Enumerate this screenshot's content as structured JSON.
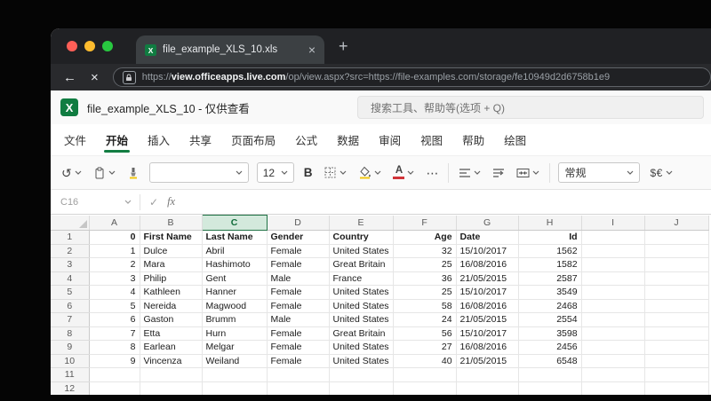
{
  "browser": {
    "tab_title": "file_example_XLS_10.xls",
    "url_prefix": "https://",
    "url_domain": "view.officeapps.live.com",
    "url_path": "/op/view.aspx?src=https://file-examples.com/storage/fe10949d2d6758b1e9"
  },
  "icons": {
    "back": "←",
    "stop": "×",
    "tab_close": "×",
    "new_tab": "+",
    "undo": "↺",
    "more": "⋯",
    "check": "✓",
    "fx": "fx"
  },
  "app": {
    "title": "file_example_XLS_10 - 仅供查看",
    "search_placeholder": "搜索工具、帮助等(选项 + Q)"
  },
  "menu": {
    "items": [
      "文件",
      "开始",
      "插入",
      "共享",
      "页面布局",
      "公式",
      "数据",
      "审阅",
      "视图",
      "帮助",
      "绘图"
    ],
    "keys": [
      "file",
      "home",
      "insert",
      "share",
      "page-layout",
      "formulas",
      "data",
      "review",
      "view",
      "help",
      "draw"
    ],
    "active": "开始"
  },
  "toolbar": {
    "font_name": "",
    "font_size": "12",
    "bold_label": "B",
    "font_color_label": "A",
    "number_format": "常规",
    "currency": "$€",
    "accent_green": "#127d42",
    "font_color_red": "#d13438",
    "highlight_yellow": "#f2c811"
  },
  "formula_bar": {
    "name_box": "C16"
  },
  "grid": {
    "columns": [
      "A",
      "B",
      "C",
      "D",
      "E",
      "F",
      "G",
      "H",
      "I",
      "J"
    ],
    "selected_column": "C",
    "rows": [
      {
        "n": "1",
        "c": [
          "0",
          "First Name",
          "Last Name",
          "Gender",
          "Country",
          "Age",
          "Date",
          "Id",
          "",
          ""
        ]
      },
      {
        "n": "2",
        "c": [
          "1",
          "Dulce",
          "Abril",
          "Female",
          "United States",
          "32",
          "15/10/2017",
          "1562",
          "",
          ""
        ]
      },
      {
        "n": "3",
        "c": [
          "2",
          "Mara",
          "Hashimoto",
          "Female",
          "Great Britain",
          "25",
          "16/08/2016",
          "1582",
          "",
          ""
        ]
      },
      {
        "n": "4",
        "c": [
          "3",
          "Philip",
          "Gent",
          "Male",
          "France",
          "36",
          "21/05/2015",
          "2587",
          "",
          ""
        ]
      },
      {
        "n": "5",
        "c": [
          "4",
          "Kathleen",
          "Hanner",
          "Female",
          "United States",
          "25",
          "15/10/2017",
          "3549",
          "",
          ""
        ]
      },
      {
        "n": "6",
        "c": [
          "5",
          "Nereida",
          "Magwood",
          "Female",
          "United States",
          "58",
          "16/08/2016",
          "2468",
          "",
          ""
        ]
      },
      {
        "n": "7",
        "c": [
          "6",
          "Gaston",
          "Brumm",
          "Male",
          "United States",
          "24",
          "21/05/2015",
          "2554",
          "",
          ""
        ]
      },
      {
        "n": "8",
        "c": [
          "7",
          "Etta",
          "Hurn",
          "Female",
          "Great Britain",
          "56",
          "15/10/2017",
          "3598",
          "",
          ""
        ]
      },
      {
        "n": "9",
        "c": [
          "8",
          "Earlean",
          "Melgar",
          "Female",
          "United States",
          "27",
          "16/08/2016",
          "2456",
          "",
          ""
        ]
      },
      {
        "n": "10",
        "c": [
          "9",
          "Vincenza",
          "Weiland",
          "Female",
          "United States",
          "40",
          "21/05/2015",
          "6548",
          "",
          ""
        ]
      },
      {
        "n": "11",
        "c": [
          "",
          "",
          "",
          "",
          "",
          "",
          "",
          "",
          "",
          ""
        ]
      },
      {
        "n": "12",
        "c": [
          "",
          "",
          "",
          "",
          "",
          "",
          "",
          "",
          "",
          ""
        ]
      }
    ]
  }
}
